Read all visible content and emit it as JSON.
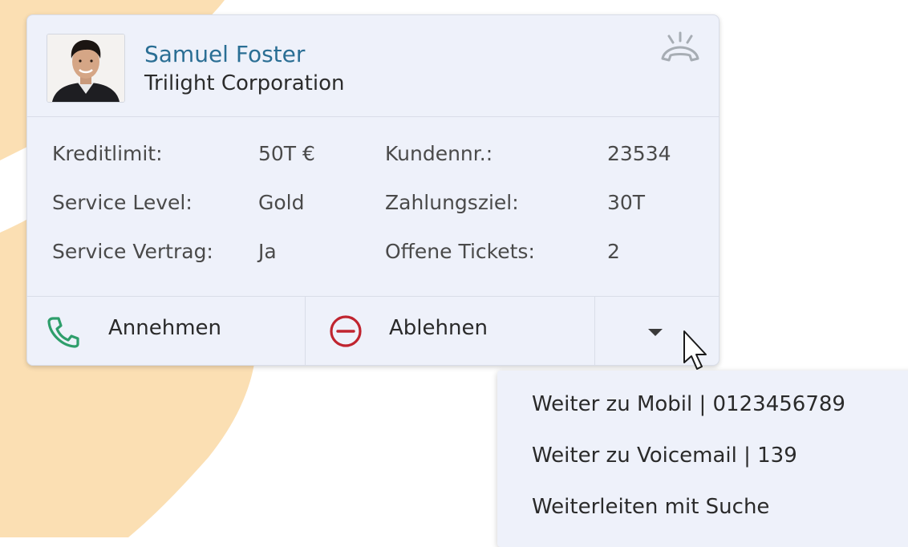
{
  "colors": {
    "background_shape": "#fbdfb3",
    "card_bg": "#eef1fa",
    "name": "#2a6e94",
    "accept_icon": "#2e9e6b",
    "reject_icon": "#c0242f",
    "hangup_icon": "#a7adb4"
  },
  "contact": {
    "name": "Samuel Foster",
    "company": "Trilight Corporation",
    "avatar_icon": "person-photo",
    "status_icon": "phone-hangup-ringing-icon"
  },
  "details": {
    "left": [
      {
        "label": "Kreditlimit:",
        "value": "50T €"
      },
      {
        "label": "Service Level:",
        "value": "Gold"
      },
      {
        "label": "Service Vertrag:",
        "value": "Ja"
      }
    ],
    "right": [
      {
        "label": "Kundennr.:",
        "value": "23534"
      },
      {
        "label": "Zahlungsziel:",
        "value": "30T"
      },
      {
        "label": "Offene Tickets:",
        "value": "2"
      }
    ]
  },
  "actions": {
    "accept_label": "Annehmen",
    "accept_icon": "phone-icon",
    "reject_label": "Ablehnen",
    "reject_icon": "minus-circle-icon",
    "more_icon": "caret-down-icon"
  },
  "dropdown": {
    "items": [
      {
        "label": "Weiter zu Mobil | 0123456789"
      },
      {
        "label": "Weiter zu Voicemail | 139"
      },
      {
        "label": "Weiterleiten mit Suche"
      }
    ]
  }
}
